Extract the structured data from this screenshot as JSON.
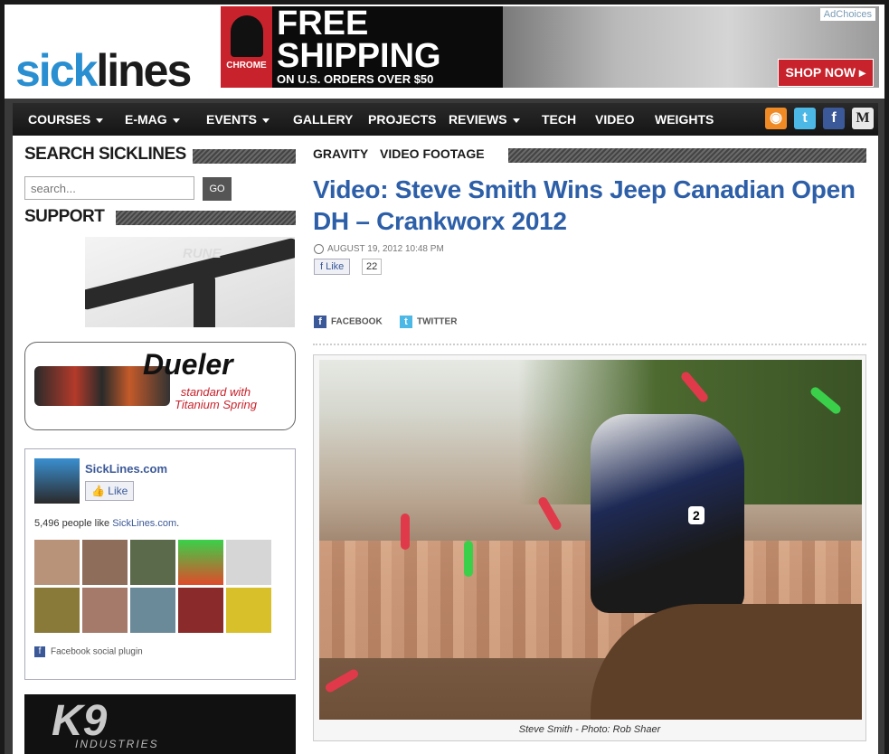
{
  "brand": {
    "logo_part1": "sick",
    "logo_part2": "lines"
  },
  "ad": {
    "brand": "CHROME",
    "headline1": "FREE",
    "headline2": "SHIPPING",
    "subline": "ON U.S. ORDERS OVER $50",
    "adchoices": "AdChoices",
    "cta": "SHOP NOW ▸"
  },
  "nav": {
    "items": [
      "COURSES",
      "E-MAG",
      "EVENTS",
      "GALLERY",
      "PROJECTS",
      "REVIEWS",
      "TECH",
      "VIDEO",
      "WEIGHTS"
    ],
    "social": [
      "rss-icon",
      "twitter-icon",
      "facebook-icon",
      "m-icon"
    ]
  },
  "sidebar": {
    "search_title": "SEARCH SICKLINES",
    "search_placeholder": "search...",
    "go": "GO",
    "support_title": "SUPPORT",
    "frame_brand": "RUNE",
    "dueler_name": "Dueler",
    "dueler_tag1": "standard with",
    "dueler_tag2": "Titanium Spring",
    "fb": {
      "page_name": "SickLines.com",
      "like": "Like",
      "count_text": "5,496 people like ",
      "count_link": "SickLines.com",
      "count_end": ".",
      "plugin": "Facebook social plugin"
    },
    "k9_mark": "K9",
    "k9_word": "INDUSTRIES"
  },
  "article": {
    "cat1": "GRAVITY",
    "cat2": "VIDEO FOOTAGE",
    "title": "Video: Steve Smith Wins Jeep Canadian Open DH – Crankworx 2012",
    "date": "AUGUST 19, 2012 10:48 PM",
    "like": "Like",
    "like_count": "22",
    "share_facebook": "FACEBOOK",
    "share_twitter": "TWITTER",
    "caption": "Steve Smith - Photo: Rob Shaer",
    "rider_number": "2"
  }
}
